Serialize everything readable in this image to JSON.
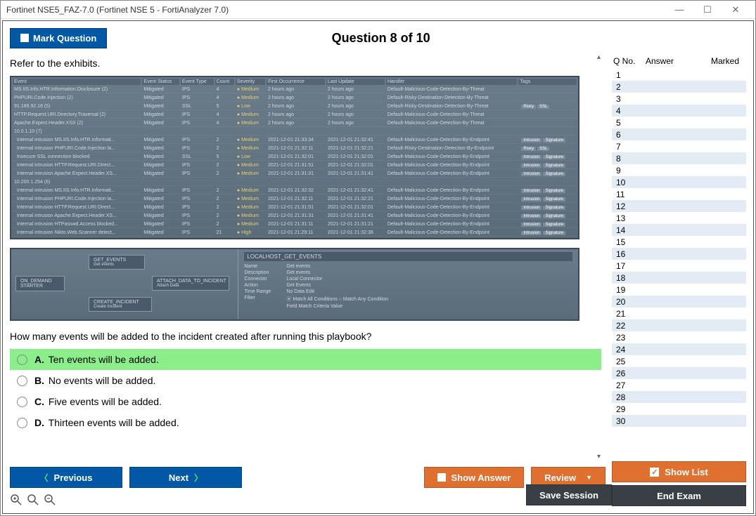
{
  "window": {
    "title": "Fortinet NSE5_FAZ-7.0 (Fortinet NSE 5 - FortiAnalyzer 7.0)"
  },
  "header": {
    "mark_label": "Mark Question",
    "question_title": "Question 8 of 10"
  },
  "question": {
    "intro": "Refer to the exhibits.",
    "prompt": "How many events will be added to the incident created after running this playbook?"
  },
  "exhibit1": {
    "columns": [
      "Event",
      "Event Status",
      "Event Type",
      "Count",
      "Severity",
      "First Occurrence",
      "Last Update",
      "Handler",
      "Tags"
    ],
    "rows": [
      {
        "event": "MS.IIS.Info.HTR.Information.Disclosure (2)",
        "status": "Mitigated",
        "type": "IPS",
        "count": "4",
        "sev": "Medium",
        "first": "2 hours ago",
        "last": "2 hours ago",
        "handler": "Default-Malicious-Code-Detection-By-Threat",
        "tags": ""
      },
      {
        "event": "PHPURI.Code.Injection (2)",
        "status": "Mitigated",
        "type": "IPS",
        "count": "4",
        "sev": "Medium",
        "first": "2 hours ago",
        "last": "2 hours ago",
        "handler": "Default-Risky-Destination-Detection-By-Threat",
        "tags": ""
      },
      {
        "event": "91.189.92.18 (5)",
        "status": "Mitigated",
        "type": "SSL",
        "count": "5",
        "sev": "Low",
        "first": "2 hours ago",
        "last": "2 hours ago",
        "handler": "Default-Risky-Destination-Detection-By-Threat",
        "tags": "Risky SSL"
      },
      {
        "event": "HTTP.Request.URI.Directory.Traversal (2)",
        "status": "Mitigated",
        "type": "IPS",
        "count": "4",
        "sev": "Medium",
        "first": "2 hours ago",
        "last": "2 hours ago",
        "handler": "Default-Malicious-Code-Detection-By-Threat",
        "tags": ""
      },
      {
        "event": "Apache.Expect.Header.XSS (2)",
        "status": "Mitigated",
        "type": "IPS",
        "count": "4",
        "sev": "Medium",
        "first": "2 hours ago",
        "last": "2 hours ago",
        "handler": "Default-Malicious-Code-Detection-By-Threat",
        "tags": ""
      },
      {
        "event": "10.0.1.10 (7)",
        "status": "",
        "type": "",
        "count": "",
        "sev": "",
        "first": "",
        "last": "",
        "handler": "",
        "tags": ""
      },
      {
        "event": "  Internal intrusion MS.IIS.Info.HTR.Informati...",
        "status": "Mitigated",
        "type": "IPS",
        "count": "2",
        "sev": "Medium",
        "first": "2021-12-01 21:33:34",
        "last": "2021-12-01 21:32:41",
        "handler": "Default-Malicious-Code-Detection-By-Endpoint",
        "tags": "Intrusion Signature"
      },
      {
        "event": "  Internal intrusion PHPURI.Code.Injection la...",
        "status": "Mitigated",
        "type": "IPS",
        "count": "2",
        "sev": "Medium",
        "first": "2021-12-01 21:32:11",
        "last": "2021-12-01 21:32:21",
        "handler": "Default-Risky-Destination-Detection-By-Endpoint",
        "tags": "Risky SSL"
      },
      {
        "event": "  Insecure SSL connection blocked",
        "status": "Mitigated",
        "type": "SSL",
        "count": "5",
        "sev": "Low",
        "first": "2021-12-01 21:32:01",
        "last": "2021-12-01 21:32:01",
        "handler": "Default-Malicious-Code-Detection-By-Endpoint",
        "tags": "Intrusion Signature"
      },
      {
        "event": "  Internal intrusion HTTP.Request.URI.Direct...",
        "status": "Mitigated",
        "type": "IPS",
        "count": "2",
        "sev": "Medium",
        "first": "2021-12-01 21:31:51",
        "last": "2021-12-01 21:32:01",
        "handler": "Default-Malicious-Code-Detection-By-Endpoint",
        "tags": "Intrusion Signature"
      },
      {
        "event": "  Internal intrusion Apache.Expect.Header.XS...",
        "status": "Mitigated",
        "type": "IPS",
        "count": "2",
        "sev": "Medium",
        "first": "2021-12-01 21:31:31",
        "last": "2021-12-01 21:31:41",
        "handler": "Default-Malicious-Code-Detection-By-Endpoint",
        "tags": "Intrusion Signature"
      },
      {
        "event": "10.200.1.254 (6)",
        "status": "",
        "type": "",
        "count": "",
        "sev": "",
        "first": "",
        "last": "",
        "handler": "",
        "tags": ""
      },
      {
        "event": "  Internal intrusion MS.IIS.Info.HTR.Informati...",
        "status": "Mitigated",
        "type": "IPS",
        "count": "2",
        "sev": "Medium",
        "first": "2021-12-01 21:32:32",
        "last": "2021-12-01 21:32:41",
        "handler": "Default-Malicious-Code-Detection-By-Endpoint",
        "tags": "Intrusion Signature"
      },
      {
        "event": "  Internal intrusion PHPURI.Code.Injection la...",
        "status": "Mitigated",
        "type": "IPS",
        "count": "2",
        "sev": "Medium",
        "first": "2021-12-01 21:32:11",
        "last": "2021-12-01 21:32:21",
        "handler": "Default-Malicious-Code-Detection-By-Endpoint",
        "tags": "Intrusion Signature"
      },
      {
        "event": "  Internal intrusion HTTP.Request.URI.Direct...",
        "status": "Mitigated",
        "type": "IPS",
        "count": "2",
        "sev": "Medium",
        "first": "2021-12-01 21:31:51",
        "last": "2021-12-01 21:32:01",
        "handler": "Default-Malicious-Code-Detection-By-Endpoint",
        "tags": "Intrusion Signature"
      },
      {
        "event": "  Internal intrusion Apache.Expect.Header.XS...",
        "status": "Mitigated",
        "type": "IPS",
        "count": "2",
        "sev": "Medium",
        "first": "2021-12-01 21:31:31",
        "last": "2021-12-01 21:31:41",
        "handler": "Default-Malicious-Code-Detection-By-Endpoint",
        "tags": "Intrusion Signature"
      },
      {
        "event": "  Internal intrusion HTPasswd.Access blocked...",
        "status": "Mitigated",
        "type": "IPS",
        "count": "2",
        "sev": "Medium",
        "first": "2021-12-01 21:31:11",
        "last": "2021-12-01 21:31:21",
        "handler": "Default-Malicious-Code-Detection-By-Endpoint",
        "tags": "Intrusion Signature"
      },
      {
        "event": "  Internal intrusion Nikto.Web.Scanner detect...",
        "status": "Mitigated",
        "type": "IPS",
        "count": "21",
        "sev": "High",
        "first": "2021-12-01 21:29:11",
        "last": "2021-12-01 21:32:36",
        "handler": "Default-Malicious-Code-Detection-By-Endpoint",
        "tags": "Intrusion Signature"
      }
    ]
  },
  "exhibit2": {
    "nodes": {
      "start": "ON_DEMAND STARTER",
      "get": "GET_EVENTS",
      "get_sub": "Get events",
      "attach": "ATTACH_DATA_TO_INCIDENT",
      "attach_sub": "Attach Data",
      "create": "CREATE_INCIDENT",
      "create_sub": "Create Incident"
    },
    "panel_title": "LOCALHOST_GET_EVENTS",
    "fields": [
      {
        "label": "Name",
        "value": "Get events"
      },
      {
        "label": "Description",
        "value": "Get events"
      },
      {
        "label": "Connector",
        "value": "Local Connector"
      },
      {
        "label": "Action",
        "value": "Get Events"
      },
      {
        "label": "Time Range",
        "value": "No Data   Edit"
      },
      {
        "label": "Filter",
        "value": "⦿ Match All Conditions  ○ Match Any Condition"
      },
      {
        "label": "",
        "value": "Field          Match Criteria          Value"
      }
    ]
  },
  "options": [
    {
      "letter": "A.",
      "text": "Ten events will be added.",
      "selected": true
    },
    {
      "letter": "B.",
      "text": "No events will be added.",
      "selected": false
    },
    {
      "letter": "C.",
      "text": "Five events will be added.",
      "selected": false
    },
    {
      "letter": "D.",
      "text": "Thirteen events will be added.",
      "selected": false
    }
  ],
  "side": {
    "head_no": "Q No.",
    "head_ans": "Answer",
    "head_mark": "Marked",
    "rows": [
      1,
      2,
      3,
      4,
      5,
      6,
      7,
      8,
      9,
      10,
      11,
      12,
      13,
      14,
      15,
      16,
      17,
      18,
      19,
      20,
      21,
      22,
      23,
      24,
      25,
      26,
      27,
      28,
      29,
      30
    ]
  },
  "footer": {
    "previous": "Previous",
    "next": "Next",
    "show_answer": "Show Answer",
    "review": "Review",
    "show_list": "Show List",
    "save": "Save Session",
    "end": "End Exam"
  }
}
